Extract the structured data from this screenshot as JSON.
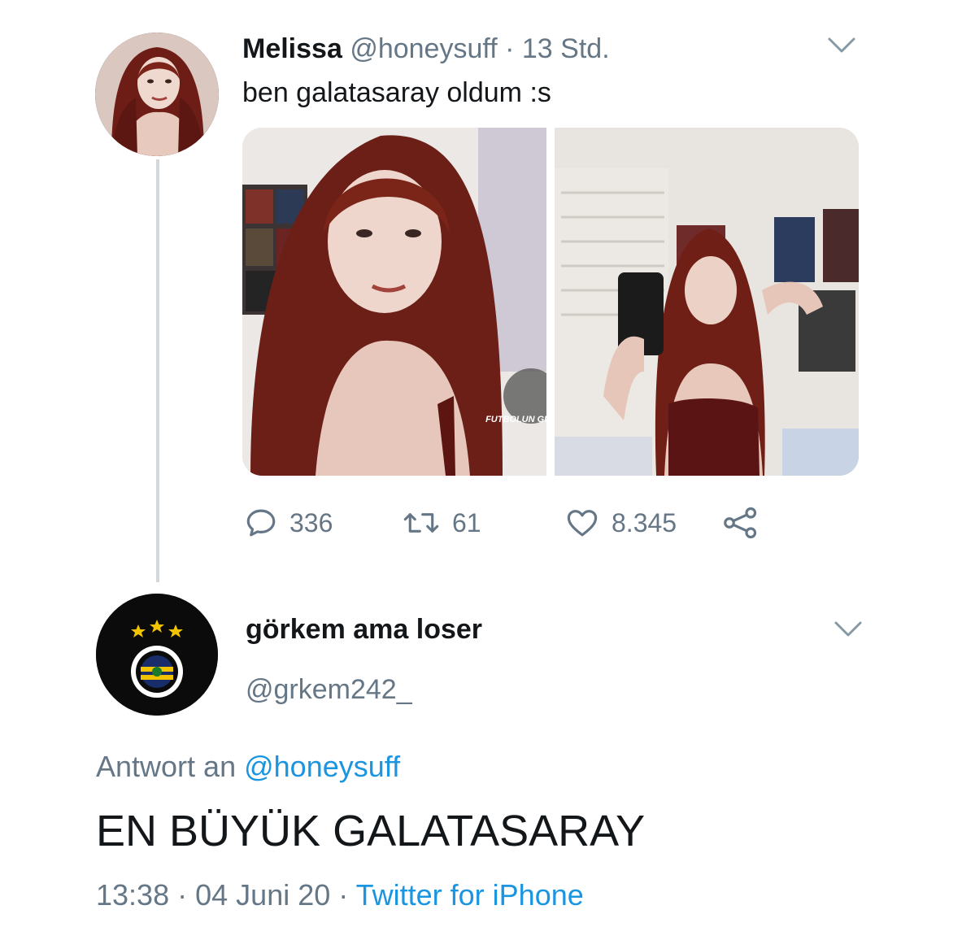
{
  "tweet1": {
    "name": "Melissa",
    "handle": "@honeysuff",
    "separator": "·",
    "time": "13 Std.",
    "text": "ben galatasaray oldum :s",
    "watermark": "FUTBOLUN GÜRÜNÜ",
    "stats": {
      "replies": "336",
      "retweets": "61",
      "likes": "8.345"
    },
    "icons": [
      "reply-icon",
      "retweet-icon",
      "like-icon",
      "share-icon",
      "chevron-down-icon"
    ]
  },
  "tweet2": {
    "name": "görkem ama loser",
    "handle": "@grkem242_",
    "reply_prefix": "Antwort an",
    "reply_mention": "@honeysuff",
    "text": "EN BÜYÜK GALATASARAY",
    "time": "13:38",
    "separator": "·",
    "date": "04 Juni 20",
    "source": "Twitter for iPhone",
    "avatar_logo": "fenerbahce-crest"
  },
  "colors": {
    "text": "#14171a",
    "secondary": "#657786",
    "link": "#1b95e0",
    "thread_line": "#d3d8dc"
  }
}
